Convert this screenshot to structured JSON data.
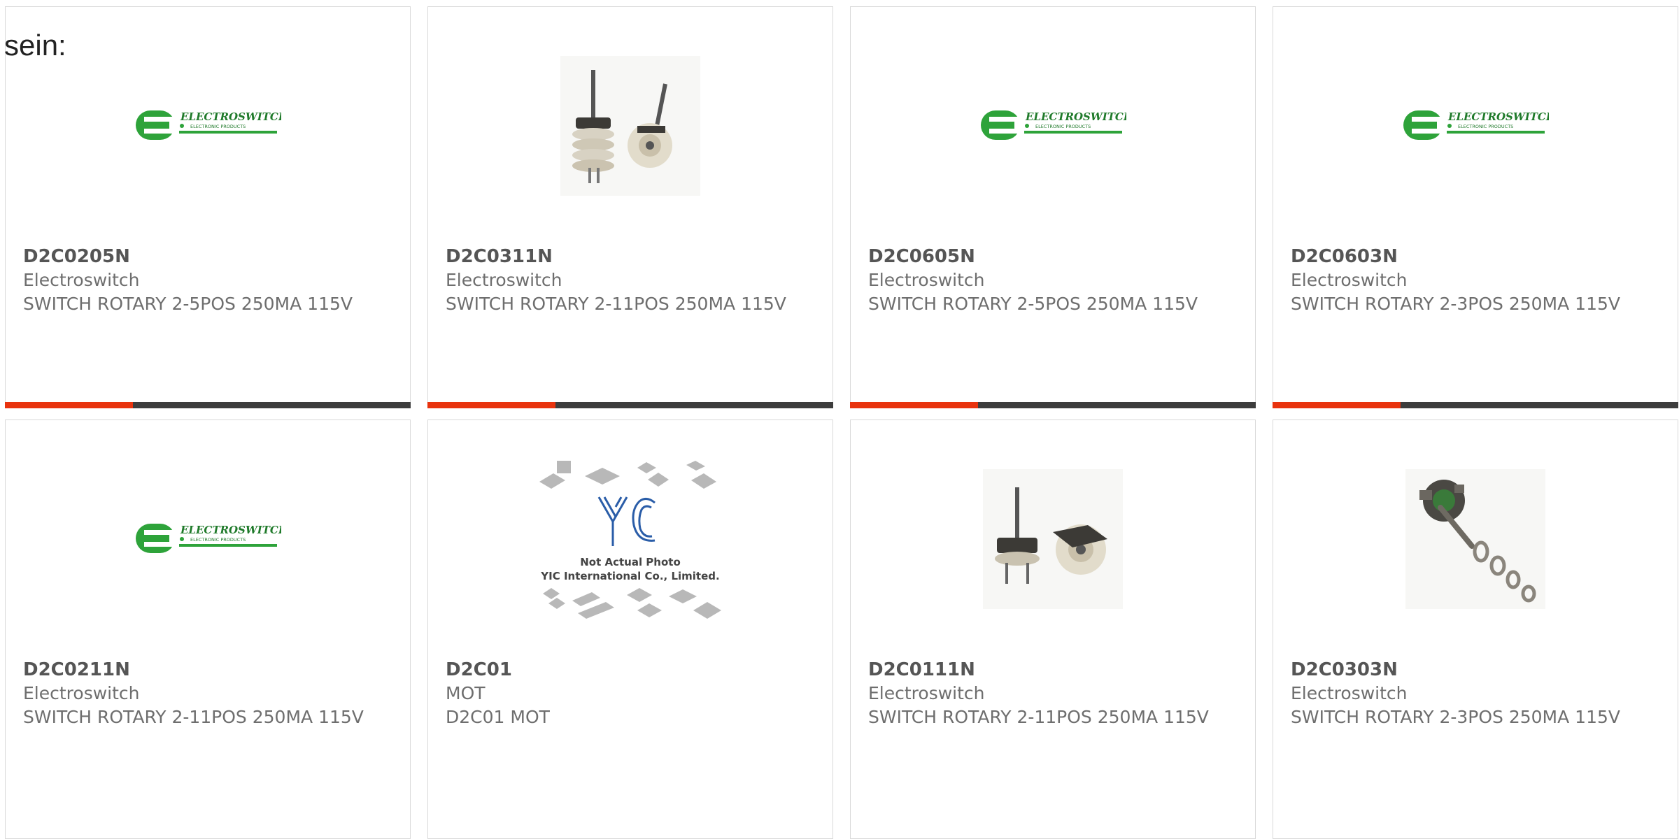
{
  "intro_text": "sein:",
  "colors": {
    "accent": "#e8330e",
    "bar": "#3d3d3d",
    "logo_green": "#2ea33a"
  },
  "products": [
    {
      "part_number": "D2C0205N",
      "manufacturer": "Electroswitch",
      "description": "SWITCH ROTARY 2-5POS 250MA 115V",
      "image": "electroswitch-logo"
    },
    {
      "part_number": "D2C0311N",
      "manufacturer": "Electroswitch",
      "description": "SWITCH ROTARY 2-11POS 250MA 115V",
      "image": "rotary-switch-photo"
    },
    {
      "part_number": "D2C0605N",
      "manufacturer": "Electroswitch",
      "description": "SWITCH ROTARY 2-5POS 250MA 115V",
      "image": "electroswitch-logo"
    },
    {
      "part_number": "D2C0603N",
      "manufacturer": "Electroswitch",
      "description": "SWITCH ROTARY 2-3POS 250MA 115V",
      "image": "electroswitch-logo"
    },
    {
      "part_number": "D2C0211N",
      "manufacturer": "Electroswitch",
      "description": "SWITCH ROTARY 2-11POS 250MA 115V",
      "image": "electroswitch-logo"
    },
    {
      "part_number": "D2C01",
      "manufacturer": "MOT",
      "description": "D2C01 MOT",
      "image": "yic-placeholder"
    },
    {
      "part_number": "D2C0111N",
      "manufacturer": "Electroswitch",
      "description": "SWITCH ROTARY 2-11POS 250MA 115V",
      "image": "rotary-switch-photo"
    },
    {
      "part_number": "D2C0303N",
      "manufacturer": "Electroswitch",
      "description": "SWITCH ROTARY 2-3POS 250MA 115V",
      "image": "rotary-switch-single-photo"
    }
  ],
  "logo": {
    "brand": "ELECTROSWITCH",
    "tagline": "ELECTRONIC PRODUCTS"
  },
  "placeholder": {
    "brand": "YIC",
    "line1": "Not Actual Photo",
    "line2": "YIC International Co., Limited."
  }
}
